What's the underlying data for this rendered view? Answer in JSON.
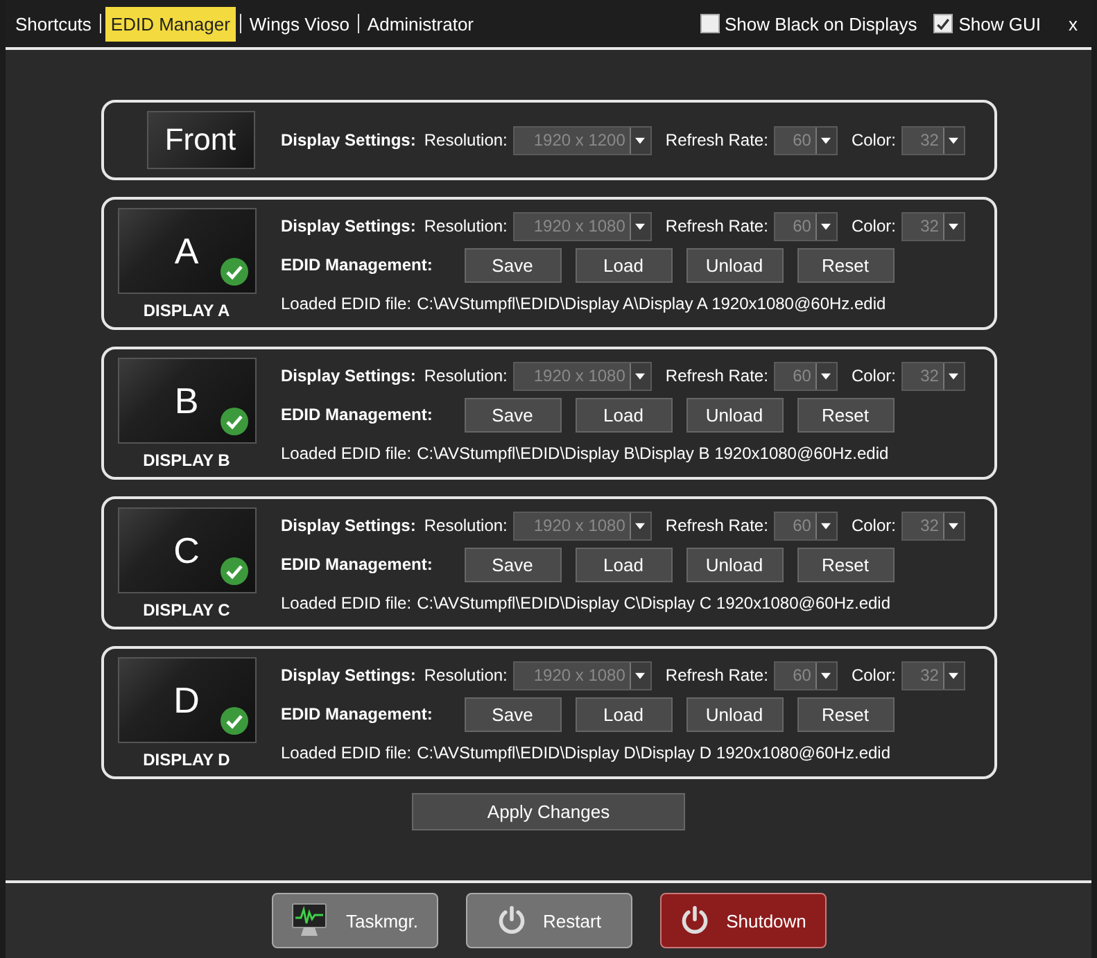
{
  "tabs": [
    {
      "label": "Shortcuts",
      "selected": false
    },
    {
      "label": "EDID Manager",
      "selected": true
    },
    {
      "label": "Wings Vioso",
      "selected": false
    },
    {
      "label": "Administrator",
      "selected": false
    }
  ],
  "toggles": [
    {
      "label": "Show Black on Displays",
      "checked": false
    },
    {
      "label": "Show GUI",
      "checked": true
    }
  ],
  "close": "x",
  "front": {
    "label": "Front",
    "settings": {
      "title": "Display Settings:",
      "resolution_label": "Resolution:",
      "resolution": "1920 x 1200",
      "refresh_label": "Refresh Rate:",
      "refresh": "60",
      "color_label": "Color:",
      "color_depth": "32"
    }
  },
  "displays": [
    {
      "letter": "A",
      "name": "DISPLAY A",
      "loaded": true,
      "settings": {
        "title": "Display Settings:",
        "resolution_label": "Resolution:",
        "resolution": "1920 x 1080",
        "refresh_label": "Refresh Rate:",
        "refresh": "60",
        "color_label": "Color:",
        "color_depth": "32"
      },
      "edid_label": "EDID Management:",
      "buttons": [
        "Save",
        "Load",
        "Unload",
        "Reset"
      ],
      "file_label": "Loaded EDID file:",
      "file_path": "C:\\AVStumpfl\\EDID\\Display A\\Display A 1920x1080@60Hz.edid"
    },
    {
      "letter": "B",
      "name": "DISPLAY B",
      "loaded": true,
      "settings": {
        "title": "Display Settings:",
        "resolution_label": "Resolution:",
        "resolution": "1920 x 1080",
        "refresh_label": "Refresh Rate:",
        "refresh": "60",
        "color_label": "Color:",
        "color_depth": "32"
      },
      "edid_label": "EDID Management:",
      "buttons": [
        "Save",
        "Load",
        "Unload",
        "Reset"
      ],
      "file_label": "Loaded EDID file:",
      "file_path": "C:\\AVStumpfl\\EDID\\Display B\\Display B 1920x1080@60Hz.edid"
    },
    {
      "letter": "C",
      "name": "DISPLAY C",
      "loaded": true,
      "settings": {
        "title": "Display Settings:",
        "resolution_label": "Resolution:",
        "resolution": "1920 x 1080",
        "refresh_label": "Refresh Rate:",
        "refresh": "60",
        "color_label": "Color:",
        "color_depth": "32"
      },
      "edid_label": "EDID Management:",
      "buttons": [
        "Save",
        "Load",
        "Unload",
        "Reset"
      ],
      "file_label": "Loaded EDID file:",
      "file_path": "C:\\AVStumpfl\\EDID\\Display C\\Display C 1920x1080@60Hz.edid"
    },
    {
      "letter": "D",
      "name": "DISPLAY D",
      "loaded": true,
      "settings": {
        "title": "Display Settings:",
        "resolution_label": "Resolution:",
        "resolution": "1920 x 1080",
        "refresh_label": "Refresh Rate:",
        "refresh": "60",
        "color_label": "Color:",
        "color_depth": "32"
      },
      "edid_label": "EDID Management:",
      "buttons": [
        "Save",
        "Load",
        "Unload",
        "Reset"
      ],
      "file_label": "Loaded EDID file:",
      "file_path": "C:\\AVStumpfl\\EDID\\Display D\\Display D 1920x1080@60Hz.edid"
    }
  ],
  "apply": "Apply Changes",
  "footer_buttons": [
    {
      "label": "Taskmgr.",
      "kind": "taskmgr"
    },
    {
      "label": "Restart",
      "kind": "restart"
    },
    {
      "label": "Shutdown",
      "kind": "shutdown"
    }
  ]
}
